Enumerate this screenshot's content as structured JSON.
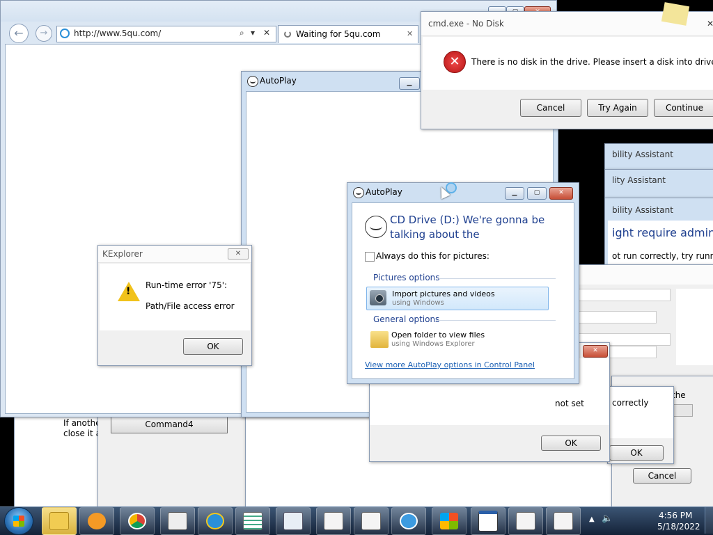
{
  "browser": {
    "url": "http://www.5qu.com/",
    "tab_label": "Waiting for 5qu.com",
    "search_icon": "magnifier",
    "refresh_glyph": "▾",
    "stop_glyph": "✕",
    "tab_close": "✕"
  },
  "cmd_dialog": {
    "title": "cmd.exe - No Disk",
    "message": "There is no disk in the drive. Please insert a disk into drive D:.",
    "cancel": "Cancel",
    "try_again": "Try Again",
    "continue": "Continue",
    "close_glyph": "✕"
  },
  "autoplay_back": {
    "title": "AutoPlay"
  },
  "compat": {
    "title1": "bility Assistant",
    "title2": "lity Assistant",
    "title3": "bility Assistant",
    "heading": "ight require administ",
    "body": "ot run correctly, try running"
  },
  "kexplorer": {
    "title": "KExplorer",
    "line1": "Run-time error '75':",
    "line2": "Path/File access error",
    "ok": "OK",
    "close_glyph": "✕"
  },
  "autoplay": {
    "title": "AutoPlay",
    "heading": "CD Drive (D:) We're gonna be talking about the",
    "always_label": "Always do this for pictures:",
    "pictures_section": "Pictures options",
    "import_title": "Import pictures and videos",
    "import_sub": "using Windows",
    "general_section": "General options",
    "folder_title": "Open folder to view files",
    "folder_sub": "using Windows Explorer",
    "more_link": "View more AutoPlay options in Control Panel"
  },
  "back_windows": {
    "if_another": "If anothe",
    "close_it": "close it a",
    "command4": "Command4",
    "not_set": "not set",
    "ok1": "OK",
    "correctly": "correctly",
    "the": "the",
    "ok2": "OK",
    "cancel": "Cancel"
  },
  "taskbar": {
    "time": "4:56 PM",
    "date": "5/18/2022",
    "tray_arrow": "▲",
    "volume_glyph": "🔈"
  },
  "colors": {
    "taskbar": "#1c2c45",
    "error_red": "#d42121",
    "link_blue": "#1a5fb4",
    "aero_frame": "#cfe0f2"
  }
}
